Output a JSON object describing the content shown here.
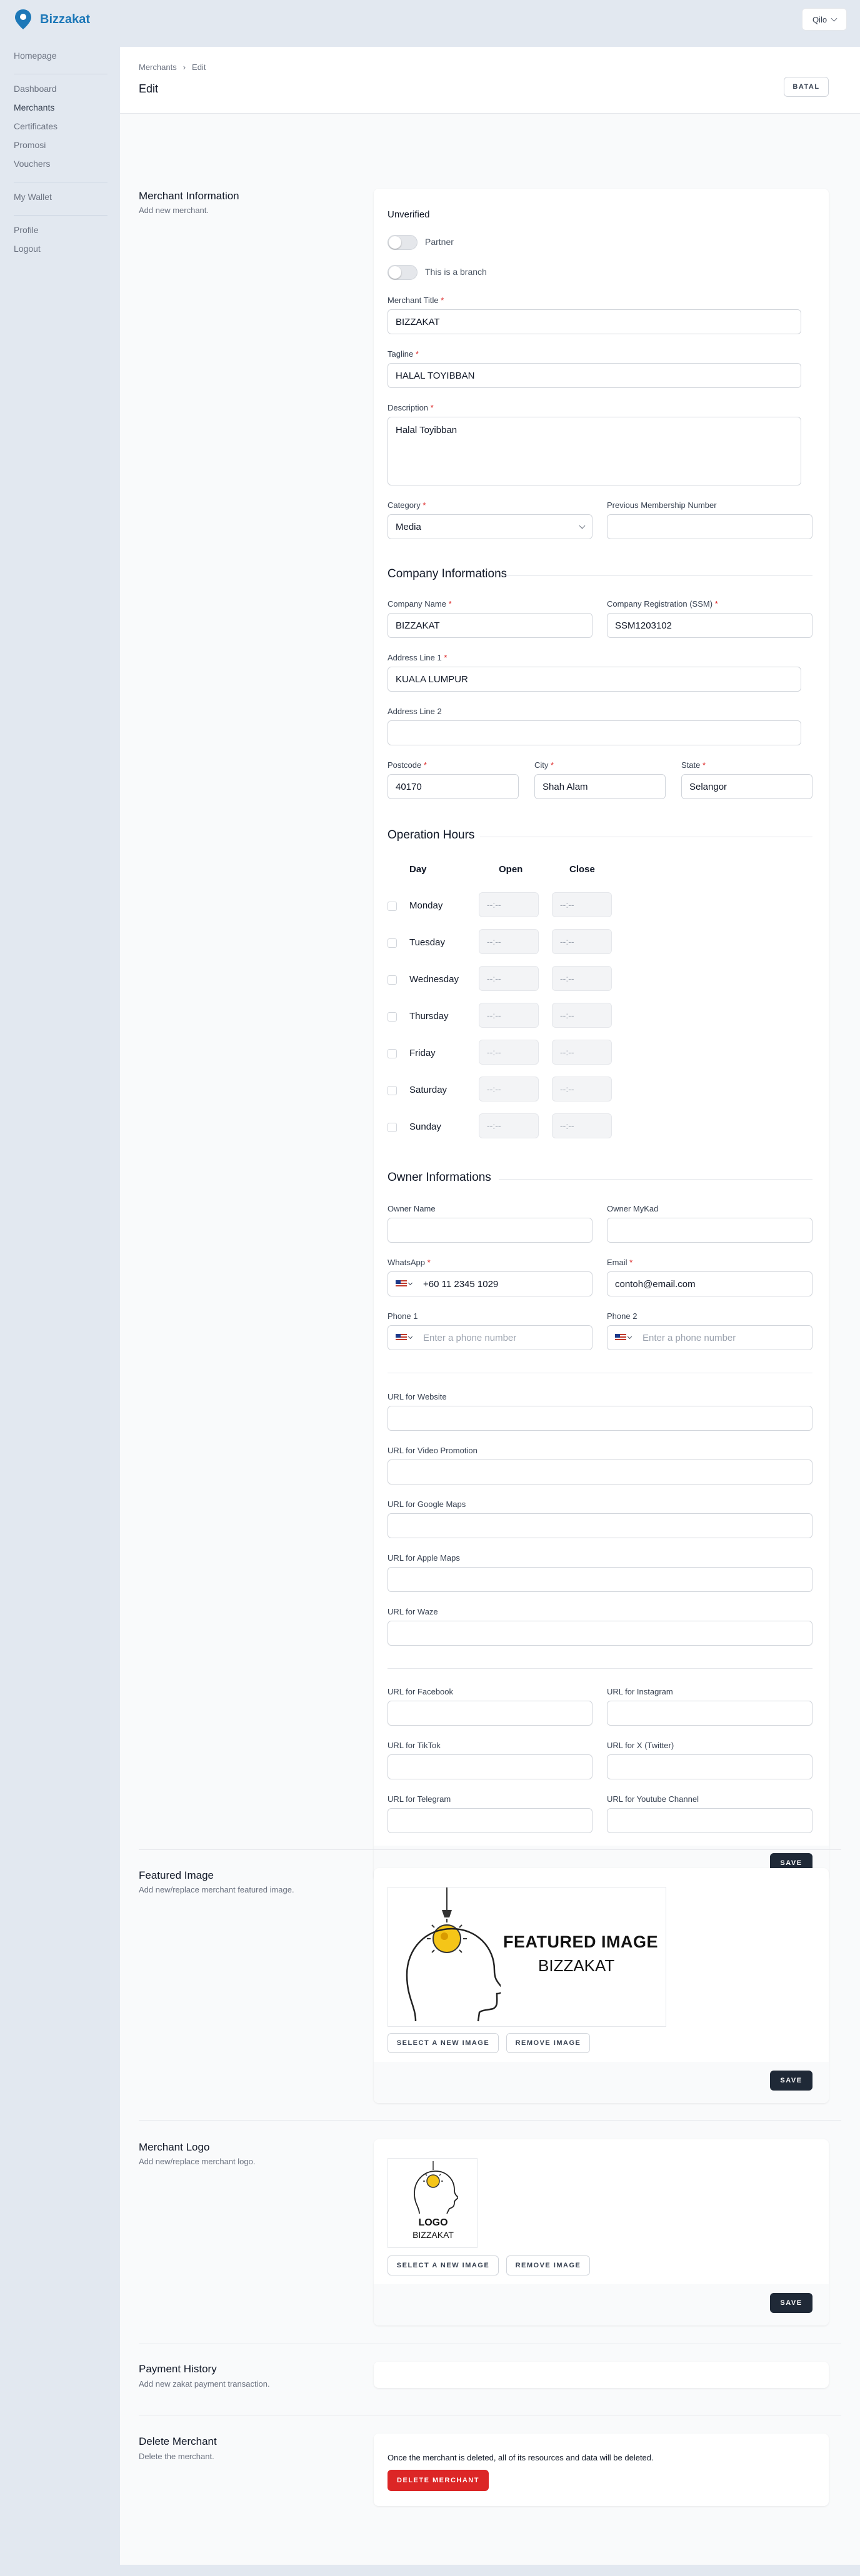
{
  "app": {
    "name": "Bizzakat",
    "user": "Qilo"
  },
  "sidebar": {
    "group1": [
      "Homepage"
    ],
    "group2": [
      "Dashboard",
      "Merchants",
      "Certificates",
      "Promosi",
      "Vouchers"
    ],
    "group3": [
      "My Wallet"
    ],
    "group4": [
      "Profile",
      "Logout"
    ]
  },
  "header": {
    "breadcrumb": [
      "Merchants",
      "Edit"
    ],
    "title": "Edit",
    "cancel_label": "BATAL"
  },
  "merchant_info": {
    "title": "Merchant Information",
    "description": "Add new merchant.",
    "status": "Unverified",
    "toggle_partner": "Partner",
    "toggle_branch": "This is a branch",
    "fields": {
      "merchant_title": {
        "label": "Merchant Title",
        "value": "BIZZAKAT"
      },
      "tagline": {
        "label": "Tagline",
        "value": "HALAL TOYIBBAN"
      },
      "description": {
        "label": "Description",
        "value": "Halal Toyibban"
      },
      "category": {
        "label": "Category",
        "value": "Media"
      },
      "prev_membership": {
        "label": "Previous Membership Number",
        "value": ""
      }
    },
    "company": {
      "heading": "Company Informations",
      "company_name": {
        "label": "Company Name",
        "value": "BIZZAKAT"
      },
      "company_reg": {
        "label": "Company Registration (SSM)",
        "value": "SSM1203102"
      },
      "address1": {
        "label": "Address Line 1",
        "value": "KUALA LUMPUR"
      },
      "address2": {
        "label": "Address Line 2",
        "value": ""
      },
      "postcode": {
        "label": "Postcode",
        "value": "40170"
      },
      "city": {
        "label": "City",
        "value": "Shah Alam"
      },
      "state": {
        "label": "State",
        "value": "Selangor"
      }
    },
    "hours": {
      "heading": "Operation Hours",
      "col_day": "Day",
      "col_open": "Open",
      "col_close": "Close",
      "placeholder": "--:--",
      "days": [
        "Monday",
        "Tuesday",
        "Wednesday",
        "Thursday",
        "Friday",
        "Saturday",
        "Sunday"
      ]
    },
    "owner": {
      "heading": "Owner Informations",
      "owner_name": {
        "label": "Owner Name",
        "value": ""
      },
      "owner_mykad": {
        "label": "Owner MyKad",
        "value": ""
      },
      "whatsapp": {
        "label": "WhatsApp",
        "value": "+60 11 2345 1029"
      },
      "email": {
        "label": "Email",
        "value": "contoh@email.com"
      },
      "phone1": {
        "label": "Phone 1",
        "placeholder": "Enter a phone number"
      },
      "phone2": {
        "label": "Phone 2",
        "placeholder": "Enter a phone number"
      }
    },
    "urls": {
      "website": "URL for Website",
      "video": "URL for Video Promotion",
      "google_maps": "URL for Google Maps",
      "apple_maps": "URL for Apple Maps",
      "waze": "URL for Waze",
      "facebook": "URL for Facebook",
      "instagram": "URL for Instagram",
      "tiktok": "URL for TikTok",
      "x": "URL for X (Twitter)",
      "telegram": "URL for Telegram",
      "youtube": "URL for Youtube Channel"
    },
    "save_label": "SAVE"
  },
  "featured_image": {
    "title": "Featured Image",
    "description": "Add new/replace merchant featured image.",
    "image_text1": "FEATURED IMAGE",
    "image_text2": "BIZZAKAT",
    "select_label": "SELECT A NEW IMAGE",
    "remove_label": "REMOVE IMAGE",
    "save_label": "SAVE"
  },
  "merchant_logo": {
    "title": "Merchant Logo",
    "description": "Add new/replace merchant logo.",
    "image_text1": "LOGO",
    "image_text2": "BIZZAKAT",
    "select_label": "SELECT A NEW IMAGE",
    "remove_label": "REMOVE IMAGE",
    "save_label": "SAVE"
  },
  "payment_history": {
    "title": "Payment History",
    "description": "Add new zakat payment transaction."
  },
  "delete_merchant": {
    "title": "Delete Merchant",
    "description": "Delete the merchant.",
    "warning": "Once the merchant is deleted, all of its resources and data will be deleted.",
    "button_label": "DELETE MERCHANT"
  },
  "colors": {
    "brand": "#1d78b8",
    "danger": "#dc2626",
    "dark_button": "#1f2937"
  }
}
